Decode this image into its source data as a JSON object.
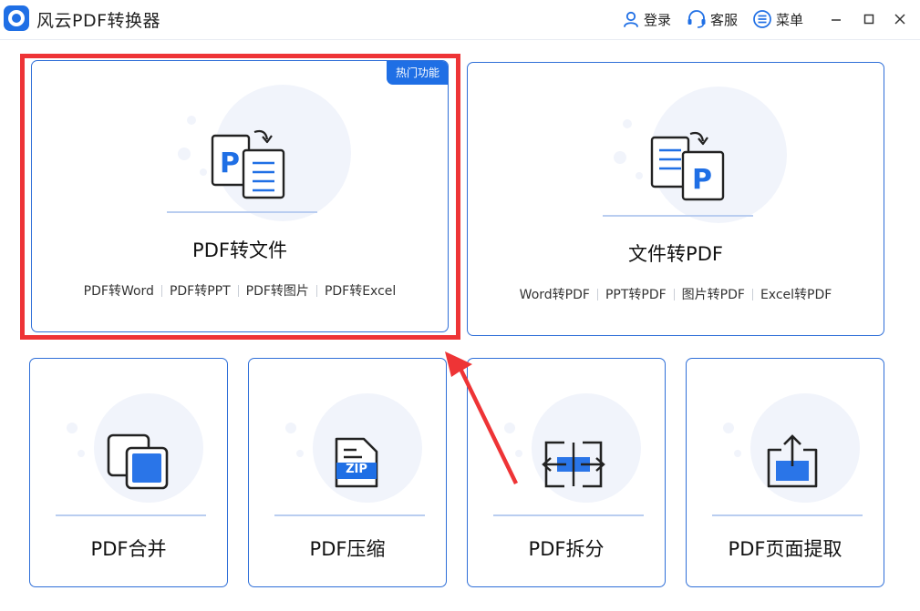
{
  "app": {
    "title": "风云PDF转换器",
    "actions": {
      "login": "登录",
      "service": "客服",
      "menu": "菜单"
    }
  },
  "colors": {
    "accent": "#1f6fe5",
    "border": "#2f6fd8",
    "highlight": "#ee3436"
  },
  "icons": {
    "app_logo": "app-logo-icon",
    "login": "user-icon",
    "service": "headset-icon",
    "menu": "menu-icon",
    "minimize": "minimize-icon",
    "maximize": "maximize-icon",
    "close": "close-icon"
  },
  "cards": {
    "pdf_to_file": {
      "title": "PDF转文件",
      "badge": "热门功能",
      "links": [
        "PDF转Word",
        "PDF转PPT",
        "PDF转图片",
        "PDF转Excel"
      ]
    },
    "file_to_pdf": {
      "title": "文件转PDF",
      "links": [
        "Word转PDF",
        "PPT转PDF",
        "图片转PDF",
        "Excel转PDF"
      ]
    },
    "merge": {
      "title": "PDF合并"
    },
    "compress": {
      "title": "PDF压缩",
      "icon_text": "ZIP"
    },
    "split": {
      "title": "PDF拆分"
    },
    "extract": {
      "title": "PDF页面提取"
    }
  }
}
